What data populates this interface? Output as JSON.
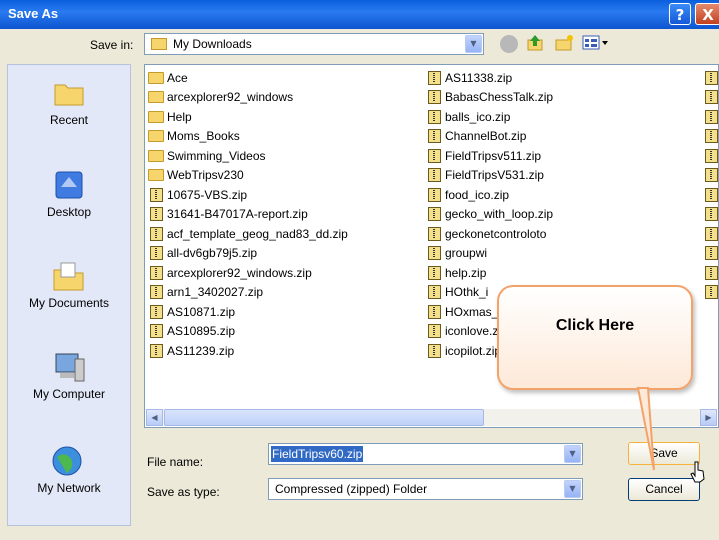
{
  "window": {
    "title": "Save As",
    "help_label": "?",
    "close_label": "X"
  },
  "toolbar": {
    "save_in_label": "Save in:",
    "save_in_value": "My Downloads",
    "icons": [
      "back-icon",
      "up-folder-icon",
      "new-folder-icon",
      "views-menu-icon"
    ]
  },
  "places": [
    {
      "label": "Recent",
      "icon": "recent-icon"
    },
    {
      "label": "Desktop",
      "icon": "desktop-icon"
    },
    {
      "label": "My Documents",
      "icon": "my-documents-icon"
    },
    {
      "label": "My Computer",
      "icon": "my-computer-icon"
    },
    {
      "label": "My Network",
      "icon": "my-network-icon"
    }
  ],
  "files": {
    "column1": [
      {
        "name": "Ace",
        "type": "folder"
      },
      {
        "name": "arcexplorer92_windows",
        "type": "folder"
      },
      {
        "name": "Help",
        "type": "folder"
      },
      {
        "name": "Moms_Books",
        "type": "folder"
      },
      {
        "name": "Swimming_Videos",
        "type": "folder"
      },
      {
        "name": "WebTripsv230",
        "type": "folder"
      },
      {
        "name": "10675-VBS.zip",
        "type": "zip"
      },
      {
        "name": "31641-B47017A-report.zip",
        "type": "zip"
      },
      {
        "name": "acf_template_geog_nad83_dd.zip",
        "type": "zip"
      },
      {
        "name": "all-dv6gb79j5.zip",
        "type": "zip"
      },
      {
        "name": "arcexplorer92_windows.zip",
        "type": "zip"
      },
      {
        "name": "arn1_3402027.zip",
        "type": "zip"
      },
      {
        "name": "AS10871.zip",
        "type": "zip"
      },
      {
        "name": "AS10895.zip",
        "type": "zip"
      },
      {
        "name": "AS11239.zip",
        "type": "zip"
      }
    ],
    "column2": [
      {
        "name": "AS11338.zip",
        "type": "zip"
      },
      {
        "name": "BabasChessTalk.zip",
        "type": "zip"
      },
      {
        "name": "balls_ico.zip",
        "type": "zip"
      },
      {
        "name": "ChannelBot.zip",
        "type": "zip"
      },
      {
        "name": "FieldTripsv511.zip",
        "type": "zip"
      },
      {
        "name": "FieldTripsV531.zip",
        "type": "zip"
      },
      {
        "name": "food_ico.zip",
        "type": "zip"
      },
      {
        "name": "gecko_with_loop.zip",
        "type": "zip"
      },
      {
        "name": "geckonetcontroloto",
        "type": "zip"
      },
      {
        "name": "groupwi",
        "type": "zip"
      },
      {
        "name": "help.zip",
        "type": "zip"
      },
      {
        "name": "HOthk_i",
        "type": "zip"
      },
      {
        "name": "HOxmas_",
        "type": "zip"
      },
      {
        "name": "iconlove.zip",
        "type": "zip"
      },
      {
        "name": "icopilot.zip",
        "type": "zip"
      }
    ]
  },
  "form": {
    "file_name_label": "File name:",
    "file_name_value": "FieldTripsv60.zip",
    "save_as_type_label": "Save as type:",
    "save_as_type_value": "Compressed (zipped) Folder",
    "save_button": "Save",
    "cancel_button": "Cancel"
  },
  "callout": {
    "text": "Click Here"
  },
  "colors": {
    "titlebar": "#0a5fdc",
    "dialog_bg": "#ece9d8",
    "callout_border": "#f3a36a"
  }
}
